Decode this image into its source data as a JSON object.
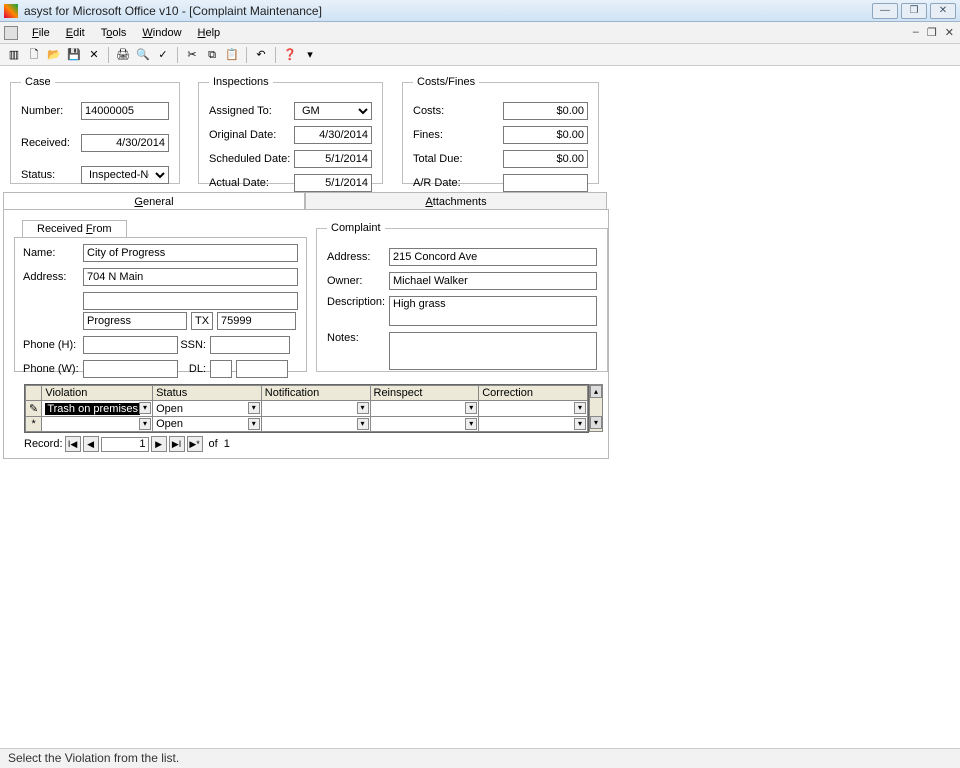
{
  "window": {
    "title": "asyst for Microsoft Office v10 - [Complaint Maintenance]"
  },
  "menu": {
    "file": "File",
    "edit": "Edit",
    "tools": "Tools",
    "window": "Window",
    "help": "Help"
  },
  "case": {
    "legend": "Case",
    "number_label": "Number:",
    "number": "14000005",
    "received_label": "Received:",
    "received": "4/30/2014",
    "status_label": "Status:",
    "status": "Inspected-Notic"
  },
  "inspections": {
    "legend": "Inspections",
    "assigned_label": "Assigned To:",
    "assigned": "GM",
    "original_label": "Original Date:",
    "original": "4/30/2014",
    "scheduled_label": "Scheduled Date:",
    "scheduled": "5/1/2014",
    "actual_label": "Actual Date:",
    "actual": "5/1/2014"
  },
  "costs": {
    "legend": "Costs/Fines",
    "costs_label": "Costs:",
    "costs": "$0.00",
    "fines_label": "Fines:",
    "fines": "$0.00",
    "total_label": "Total Due:",
    "total": "$0.00",
    "ar_label": "A/R Date:",
    "ar": ""
  },
  "tabs": {
    "general": "General",
    "attachments": "Attachments"
  },
  "received_from": {
    "tab": "Received From",
    "name_label": "Name:",
    "name": "City of Progress",
    "address_label": "Address:",
    "address1": "704 N Main",
    "address2": "",
    "city": "Progress",
    "state": "TX",
    "zip": "75999",
    "phoneh_label": "Phone (H):",
    "phoneh": "",
    "phonew_label": "Phone (W):",
    "phonew": "",
    "ssn_label": "SSN:",
    "ssn": "",
    "dl_label": "DL:",
    "dl1": "",
    "dl2": ""
  },
  "complaint": {
    "legend": "Complaint",
    "address_label": "Address:",
    "address": "215 Concord Ave",
    "owner_label": "Owner:",
    "owner": "Michael Walker",
    "desc_label": "Description:",
    "desc": "High grass",
    "notes_label": "Notes:",
    "notes": ""
  },
  "grid": {
    "headers": {
      "violation": "Violation",
      "status": "Status",
      "notification": "Notification",
      "reinspect": "Reinspect",
      "correction": "Correction"
    },
    "row1": {
      "violation": "Trash on premises",
      "status": "Open",
      "notification": "",
      "reinspect": "",
      "correction": ""
    },
    "row2": {
      "violation": "",
      "status": "Open",
      "notification": "",
      "reinspect": "",
      "correction": ""
    }
  },
  "recnav": {
    "label": "Record:",
    "pos": "1",
    "of": "of",
    "total": "1"
  },
  "statusbar": "Select the Violation from the list."
}
